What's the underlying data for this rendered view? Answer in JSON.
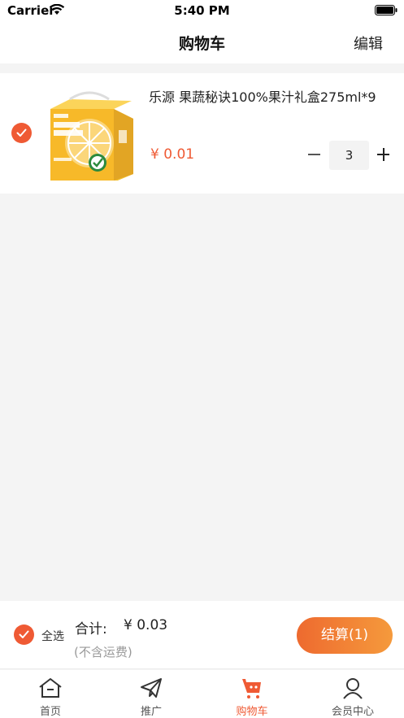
{
  "status_bar": {
    "carrier": "Carrier",
    "time": "5:40 PM"
  },
  "nav": {
    "title": "购物车",
    "edit_label": "编辑"
  },
  "cart": {
    "items": [
      {
        "title": "乐源 果蔬秘诀100%果汁礼盒275ml*9",
        "price": "¥ 0.01",
        "quantity": "3",
        "selected": true
      }
    ]
  },
  "checkout": {
    "select_all_label": "全选",
    "total_label": "合计:",
    "total_value": "¥ 0.03",
    "shipping_note": "(不含运费)",
    "button_label": "结算(1)"
  },
  "tabs": [
    {
      "label": "首页",
      "icon": "home-icon"
    },
    {
      "label": "推广",
      "icon": "send-icon"
    },
    {
      "label": "购物车",
      "icon": "cart-icon",
      "active": true
    },
    {
      "label": "会员中心",
      "icon": "user-icon"
    }
  ],
  "colors": {
    "accent": "#ef5a34",
    "button_gradient_start": "#ee6a2f",
    "button_gradient_end": "#f59a3c",
    "background": "#f4f4f4"
  }
}
